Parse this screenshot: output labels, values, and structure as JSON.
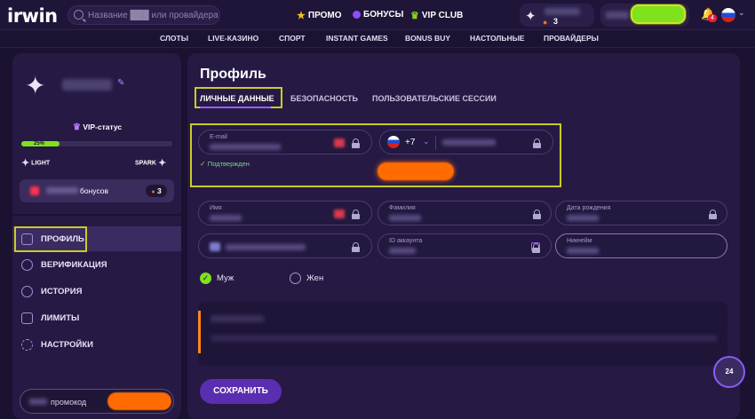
{
  "header": {
    "logo": "irwin",
    "search_placeholder": "Название ███ или провайдера",
    "nav": [
      "ПРОМО",
      "БОНУСЫ",
      "VIP CLUB"
    ],
    "user_count": "3",
    "notifications": "4"
  },
  "categories": [
    "СЛОТЫ",
    "LIVE-КАЗИНО",
    "СПОРТ",
    "INSTANT GAMES",
    "BONUS BUY",
    "НАСТОЛЬНЫЕ",
    "ПРОВАЙДЕРЫ"
  ],
  "sidebar": {
    "vip_label": "VIP-статус",
    "progress": 0.25,
    "progress_label": "25%",
    "level_from": "LIGHT",
    "level_to": "SPARK",
    "bonuses_label": "бонусов",
    "bonuses_count": "3",
    "menu": [
      "ПРОФИЛЬ",
      "ВЕРИФИКАЦИЯ",
      "ИСТОРИЯ",
      "ЛИМИТЫ",
      "НАСТРОЙКИ"
    ],
    "promo_label": "промокод"
  },
  "profile": {
    "title": "Профиль",
    "tabs": [
      "ЛИЧНЫЕ ДАННЫЕ",
      "БЕЗОПАСНОСТЬ",
      "ПОЛЬЗОВАТЕЛЬСКИЕ СЕССИИ"
    ],
    "email_label": "E-mail",
    "verified": "Подтвержден",
    "phone_code": "+7",
    "name_label": "Имя",
    "surname_label": "Фамилия",
    "birth_label": "Дата рождения",
    "account_id_label": "ID аккаунта",
    "nickname_label": "Никнейм",
    "gender_m": "Муж",
    "gender_f": "Жен",
    "save": "СОХРАНИТЬ",
    "chat_badge": "24"
  },
  "colors": {
    "accent": "#7fe21c",
    "highlight": "#c9cd23",
    "orange": "#ff6b00",
    "panel": "#261a45"
  }
}
